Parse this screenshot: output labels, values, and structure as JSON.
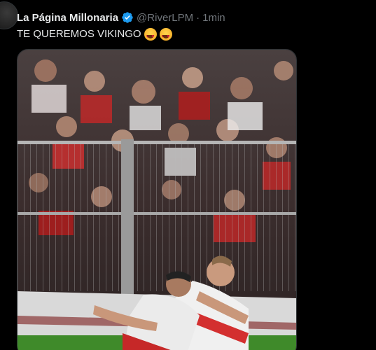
{
  "tweet": {
    "author_name": "La Página Millonaria",
    "handle": "@RiverLPM",
    "separator": "·",
    "time": "1min",
    "text": "TE QUEREMOS VIKINGO",
    "emojis": [
      "heart-eyes-emoji",
      "heart-eyes-emoji"
    ]
  },
  "colors": {
    "background": "#000000",
    "primary_text": "#e7e9ea",
    "secondary_text": "#71767b",
    "verified": "#1d9bf0",
    "border": "#2f3336"
  }
}
